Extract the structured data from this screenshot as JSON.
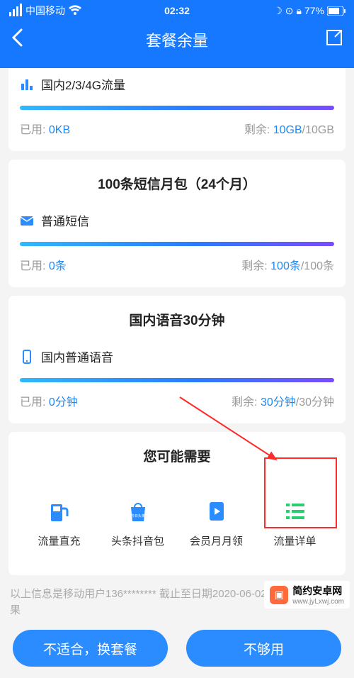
{
  "status": {
    "carrier": "中国移动",
    "time": "02:32",
    "battery": "77%"
  },
  "nav": {
    "title": "套餐余量"
  },
  "data_card": {
    "label": "国内2/3/4G流量",
    "used_label": "已用:",
    "used_value": "0KB",
    "remain_label": "剩余:",
    "remain_value": "10GB",
    "total_value": "/10GB"
  },
  "sms_card": {
    "title": "100条短信月包（24个月）",
    "label": "普通短信",
    "used_label": "已用:",
    "used_value": "0条",
    "remain_label": "剩余:",
    "remain_value": "100条",
    "total_value": "/100条"
  },
  "voice_card": {
    "title": "国内语音30分钟",
    "label": "国内普通语音",
    "used_label": "已用:",
    "used_value": "0分钟",
    "remain_label": "剩余:",
    "remain_value": "30分钟",
    "total_value": "/30分钟"
  },
  "recommend": {
    "title": "您可能需要",
    "items": [
      {
        "label": "流量直充",
        "icon": "pump-icon"
      },
      {
        "label": "头条抖音包",
        "icon": "bag-icon"
      },
      {
        "label": "会员月月领",
        "icon": "video-icon"
      },
      {
        "label": "流量详单",
        "icon": "list-icon"
      }
    ]
  },
  "footnote": "以上信息是移动用户136******** 截止至日期2020-06-02 02:32的查询结果",
  "buttons": {
    "left": "不适合，换套餐",
    "right": "不够用"
  },
  "watermark": {
    "name": "简约安卓网",
    "url": "www.jyLxwj.com"
  }
}
